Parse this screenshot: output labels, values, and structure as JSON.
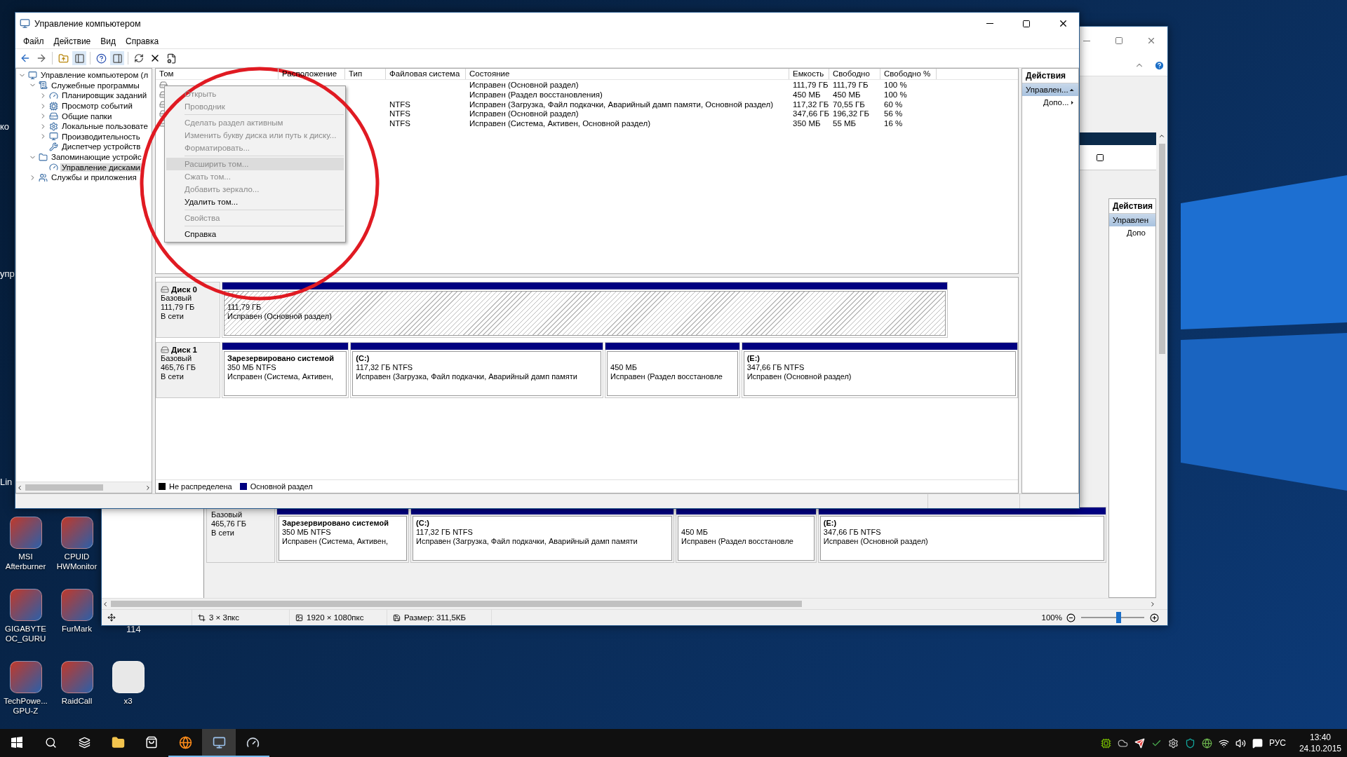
{
  "desktop": {
    "edge_labels": [
      "ко",
      "упр",
      "Lin"
    ],
    "hidden_label": "114",
    "icons": [
      {
        "label": "MSI Afterburner",
        "kind": "app"
      },
      {
        "label": "CPUID HWMonitor",
        "kind": "app"
      },
      {
        "label": "GIGABYTE OC_GURU",
        "kind": "app"
      },
      {
        "label": "FurMark",
        "kind": "app"
      },
      {
        "label": "TechPowe... GPU-Z",
        "kind": "app"
      },
      {
        "label": "RaidCall",
        "kind": "app"
      },
      {
        "label": "x3",
        "kind": "file"
      }
    ]
  },
  "viewer_window": {
    "actions": {
      "title": "Действия",
      "items": [
        {
          "label": "Управлен",
          "kind": "section"
        },
        {
          "label": "Допо",
          "kind": "item"
        }
      ]
    },
    "disk": {
      "type": "Базовый",
      "size": "465,76 ГБ",
      "status": "В сети",
      "partitions": [
        {
          "label": "Зарезервировано системой",
          "info": "350 МБ NTFS",
          "status": "Исправен (Система, Активен,"
        },
        {
          "label": "(C:)",
          "info": "117,32 ГБ NTFS",
          "status": "Исправен (Загрузка, Файл подкачки, Аварийный дамп памяти"
        },
        {
          "info": "450 МБ",
          "status": "Исправен (Раздел восстановле"
        },
        {
          "label": "(E:)",
          "info": "347,66 ГБ NTFS",
          "status": "Исправен (Основной раздел)"
        }
      ]
    },
    "status_bar": [
      "3 × 3пкс",
      "1920 × 1080пкс",
      "Размер: 311,5КБ"
    ],
    "zoom": "100%",
    "zoom_slider": {
      "level": 0.55
    }
  },
  "window": {
    "title": "Управление компьютером",
    "menu": [
      "Файл",
      "Действие",
      "Вид",
      "Справка"
    ],
    "tree": [
      {
        "label": "Управление компьютером (л",
        "expanded": true,
        "selected": false,
        "children": [
          {
            "label": "Служебные программы",
            "expanded": true,
            "selected": false,
            "children": [
              {
                "label": "Планировщик заданий",
                "expanded": false,
                "selected": false
              },
              {
                "label": "Просмотр событий",
                "expanded": false,
                "selected": false
              },
              {
                "label": "Общие папки",
                "expanded": false,
                "selected": false
              },
              {
                "label": "Локальные пользовате",
                "expanded": false,
                "selected": false
              },
              {
                "label": "Производительность",
                "expanded": false,
                "selected": false
              },
              {
                "label": "Диспетчер устройств",
                "selected": false
              }
            ]
          },
          {
            "label": "Запоминающие устройс",
            "expanded": true,
            "selected": false,
            "children": [
              {
                "label": "Управление дисками",
                "selected": true
              }
            ]
          },
          {
            "label": "Службы и приложения",
            "expanded": false,
            "selected": false
          }
        ]
      }
    ],
    "table": {
      "columns": [
        "Том",
        "Расположение",
        "Тип",
        "Файловая система",
        "Состояние",
        "Емкость",
        "Свободно",
        "Свободно %"
      ],
      "rows": [
        [
          "",
          "",
          "",
          "",
          "Исправен (Основной раздел)",
          "111,79 ГБ",
          "111,79 ГБ",
          "100 %"
        ],
        [
          "",
          "",
          "",
          "",
          "Исправен (Раздел восстановления)",
          "450 МБ",
          "450 МБ",
          "100 %"
        ],
        [
          "",
          "",
          "",
          "NTFS",
          "Исправен (Загрузка, Файл подкачки, Аварийный дамп памяти, Основной раздел)",
          "117,32 ГБ",
          "70,55 ГБ",
          "60 %"
        ],
        [
          "",
          "",
          "",
          "NTFS",
          "Исправен (Основной раздел)",
          "347,66 ГБ",
          "196,32 ГБ",
          "56 %"
        ],
        [
          "",
          "",
          "",
          "NTFS",
          "Исправен (Система, Активен, Основной раздел)",
          "350 МБ",
          "55 МБ",
          "16 %"
        ]
      ]
    },
    "context_menu": [
      {
        "kind": "item",
        "label": "Открыть",
        "disabled": true,
        "selected": false
      },
      {
        "kind": "item",
        "label": "Проводник",
        "disabled": true,
        "selected": false
      },
      {
        "kind": "separator"
      },
      {
        "kind": "item",
        "label": "Сделать раздел активным",
        "disabled": true,
        "selected": false
      },
      {
        "kind": "item",
        "label": "Изменить букву диска или путь к диску...",
        "disabled": true,
        "selected": false
      },
      {
        "kind": "item",
        "label": "Форматировать...",
        "disabled": true,
        "selected": false
      },
      {
        "kind": "separator"
      },
      {
        "kind": "item",
        "label": "Расширить том...",
        "disabled": true,
        "selected": true
      },
      {
        "kind": "item",
        "label": "Сжать том...",
        "disabled": true,
        "selected": false
      },
      {
        "kind": "item",
        "label": "Добавить зеркало...",
        "disabled": true,
        "selected": false
      },
      {
        "kind": "item",
        "label": "Удалить том...",
        "disabled": false,
        "selected": false
      },
      {
        "kind": "separator"
      },
      {
        "kind": "item",
        "label": "Свойства",
        "disabled": true,
        "selected": false
      },
      {
        "kind": "separator"
      },
      {
        "kind": "item",
        "label": "Справка",
        "disabled": false,
        "selected": false
      }
    ],
    "disks": [
      {
        "name": "Диск 0",
        "type": "Базовый",
        "size": "111,79 ГБ",
        "status": "В сети",
        "partitions": [
          {
            "info": "111,79 ГБ",
            "status": "Исправен (Основной раздел)",
            "selected": true
          }
        ]
      },
      {
        "name": "Диск 1",
        "type": "Базовый",
        "size": "465,76 ГБ",
        "status": "В сети",
        "partitions": [
          {
            "label": "Зарезервировано системой",
            "info": "350 МБ NTFS",
            "status": "Исправен (Система, Активен,",
            "selected": false
          },
          {
            "label": "(C:)",
            "info": "117,32 ГБ NTFS",
            "status": "Исправен (Загрузка, Файл подкачки, Аварийный дамп памяти",
            "selected": false
          },
          {
            "info": "450 МБ",
            "status": "Исправен (Раздел восстановле",
            "selected": false
          },
          {
            "label": "(E:)",
            "info": "347,66 ГБ NTFS",
            "status": "Исправен (Основной раздел)",
            "selected": false
          }
        ]
      }
    ],
    "legend": [
      {
        "label": "Не распределена",
        "color": "#000000"
      },
      {
        "label": "Основной раздел",
        "color": "#000080"
      }
    ],
    "actions": {
      "title": "Действия",
      "items": [
        {
          "label": "Управлен...",
          "kind": "section"
        },
        {
          "label": "Допо...",
          "kind": "item"
        }
      ]
    }
  },
  "taskbar": {
    "language": "РУС",
    "time": "13:40",
    "date": "24.10.2015"
  }
}
